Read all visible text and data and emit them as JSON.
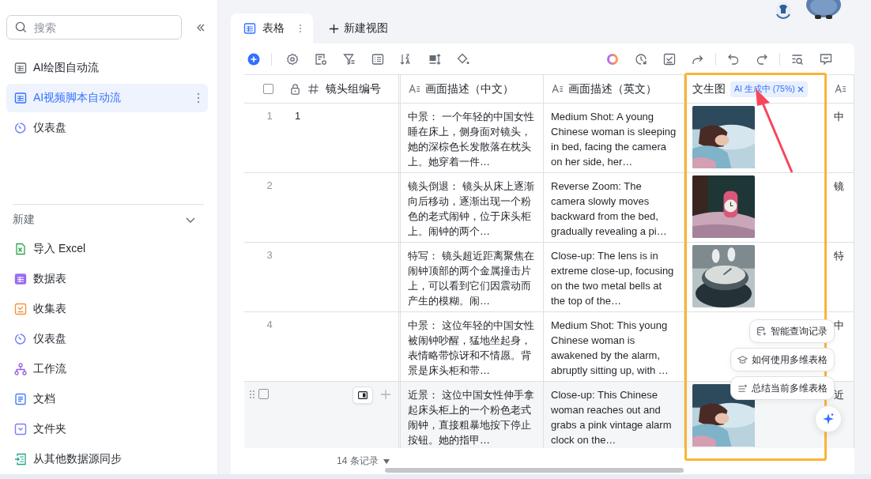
{
  "sidebar": {
    "search": {
      "placeholder": "搜索"
    },
    "items": [
      {
        "label": "AI绘图自动流",
        "selected": false
      },
      {
        "label": "AI视频脚本自动流",
        "selected": true
      },
      {
        "label": "仪表盘",
        "selected": false
      }
    ],
    "new_section": {
      "title": "新建",
      "items": [
        {
          "label": "导入 Excel"
        },
        {
          "label": "数据表"
        },
        {
          "label": "收集表"
        },
        {
          "label": "仪表盘"
        },
        {
          "label": "工作流"
        },
        {
          "label": "文档"
        },
        {
          "label": "文件夹"
        },
        {
          "label": "从其他数据源同步"
        }
      ]
    }
  },
  "tabs": [
    {
      "label": "表格",
      "selected": true
    }
  ],
  "new_view": "新建视图",
  "table": {
    "select_all": {
      "checked": false
    },
    "columns": [
      {
        "label": "镜头组编号",
        "kind": "number"
      },
      {
        "label": "画面描述（中文）",
        "kind": "text"
      },
      {
        "label": "画面描述（英文）",
        "kind": "text"
      },
      {
        "label": "文生图",
        "badge": "AI 生成中 (75%)"
      }
    ],
    "rows": [
      {
        "number": "1",
        "shot": "1",
        "hovered": false,
        "zh": "中景： 一个年轻的中国女性睡在床上，侧身面对镜头，她的深棕色长发散落在枕头上。她穿着一件…",
        "en": "Medium Shot: A young Chinese woman is sleeping in bed, facing the camera on her side, her…",
        "column_5": "中"
      },
      {
        "number": "2",
        "hovered": false,
        "zh": "镜头倒退： 镜头从床上逐渐向后移动，逐渐出现一个粉色的老式闹钟，位于床头柜上。闹钟的两个…",
        "en": "Reverse Zoom: The camera slowly moves backward from the bed, gradually revealing a pi…",
        "column_5": "镜"
      },
      {
        "number": "3",
        "hovered": false,
        "zh": "特写： 镜头超近距离聚焦在闹钟顶部的两个金属撞击片上，可以看到它们因震动而产生的模糊。闹…",
        "en": "Close-up: The lens is in extreme close-up, focusing on the two metal bells at the top of the…",
        "column_5": "特"
      },
      {
        "number": "4",
        "hovered": false,
        "zh": "中景： 这位年轻的中国女性被闹钟吵醒，猛地坐起身，表情略带惊讶和不情愿。背景是床头柜和带…",
        "en": "Medium Shot: This young Chinese woman is awakened by the alarm, abruptly sitting up, with …",
        "column_5": "中"
      },
      {
        "hovered": true,
        "checked": false,
        "zh": "近景： 这位中国女性伸手拿起床头柜上的一个粉色老式闹钟，直接粗暴地按下停止按钮。她的指甲…",
        "en": "Close-up: This Chinese woman reaches out and grabs a pink vintage alarm clock on the…",
        "column_5": "近"
      }
    ]
  },
  "records": "14 条记录",
  "assistant": {
    "suggestions": [
      "智能查询记录",
      "如何使用多维表格",
      "总结当前多维表格"
    ]
  }
}
